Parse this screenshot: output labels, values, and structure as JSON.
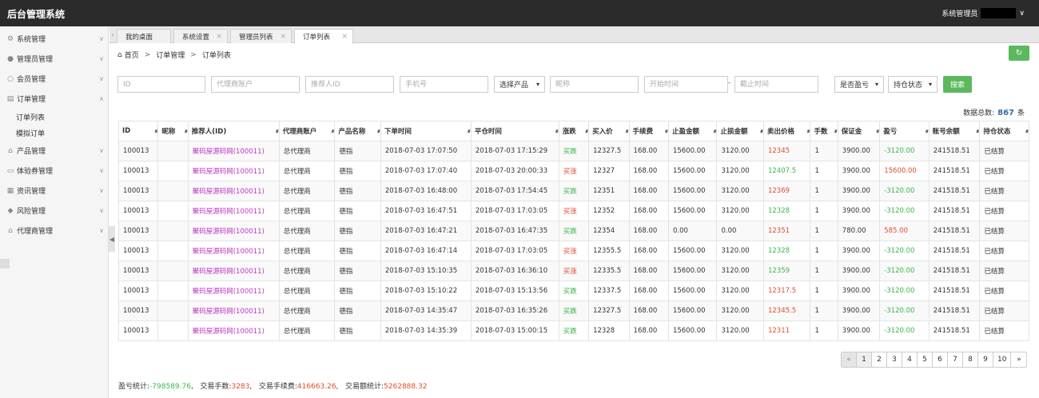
{
  "app": {
    "title": "后台管理系统",
    "user": "系统管理员"
  },
  "sidebar": {
    "items": [
      {
        "label": "系统管理",
        "icon": "gear-icon",
        "glyph": "⚙",
        "arrow": "∨"
      },
      {
        "label": "管理员管理",
        "icon": "user-icon",
        "glyph": "●",
        "arrow": "∨"
      },
      {
        "label": "会员管理",
        "icon": "member-icon",
        "glyph": "○",
        "arrow": "∨"
      },
      {
        "label": "订单管理",
        "icon": "order-icon",
        "glyph": "▤",
        "arrow": "∧"
      },
      {
        "label": "产品管理",
        "icon": "product-icon",
        "glyph": "⌂",
        "arrow": "∨"
      },
      {
        "label": "体验券管理",
        "icon": "coupon-icon",
        "glyph": "▭",
        "arrow": "∨"
      },
      {
        "label": "资讯管理",
        "icon": "news-icon",
        "glyph": "▦",
        "arrow": "∨"
      },
      {
        "label": "风险管理",
        "icon": "shield-icon",
        "glyph": "◆",
        "arrow": "∨"
      },
      {
        "label": "代理商管理",
        "icon": "agent-icon",
        "glyph": "⌂",
        "arrow": "∨"
      }
    ],
    "sub_items": [
      "订单列表",
      "模拟订单"
    ]
  },
  "tabs": [
    {
      "label": "我的桌面",
      "closable": false
    },
    {
      "label": "系统设置",
      "closable": true
    },
    {
      "label": "管理员列表",
      "closable": true
    },
    {
      "label": "订单列表",
      "closable": true,
      "active": true
    }
  ],
  "breadcrumb": [
    "首页",
    "订单管理",
    "订单列表"
  ],
  "filters": {
    "id": "ID",
    "agent_account": "代理商账户",
    "referrer_id": "推荐人ID",
    "phone": "手机号",
    "product_select": "选择产品",
    "nickname": "昵称",
    "start_time": "开始时间",
    "end_time": "截止时间",
    "profit_select": "是否盈亏",
    "position_select": "持仓状态",
    "search_label": "搜索"
  },
  "total": {
    "label": "数据总数:",
    "count": "867",
    "unit": "条"
  },
  "table": {
    "headers": [
      "ID",
      "昵称",
      "推荐人(ID)",
      "代理商账户",
      "产品名称",
      "下单时间",
      "平仓时间",
      "涨跌",
      "买入价",
      "手续费",
      "止盈金额",
      "止损金额",
      "卖出价格",
      "手数",
      "保证金",
      "盈亏",
      "账号余额",
      "持仓状态"
    ],
    "rows": [
      [
        "100013",
        "",
        "聚码屋源码网(100011)",
        "总代理商",
        "德指",
        "2018-07-03 17:07:50",
        "2018-07-03 17:15:29",
        "买跌",
        "12327.5",
        "168.00",
        "15600.00",
        "3120.00",
        "12345",
        "1",
        "3900.00",
        "-3120.00",
        "241518.51",
        "已结算"
      ],
      [
        "100013",
        "",
        "聚码屋源码网(100011)",
        "总代理商",
        "德指",
        "2018-07-03 17:07:40",
        "2018-07-03 20:00:33",
        "买涨",
        "12327",
        "168.00",
        "15600.00",
        "3120.00",
        "12407.5",
        "1",
        "3900.00",
        "15600.00",
        "241518.51",
        "已结算"
      ],
      [
        "100013",
        "",
        "聚码屋源码网(100011)",
        "总代理商",
        "德指",
        "2018-07-03 16:48:00",
        "2018-07-03 17:54:45",
        "买跌",
        "12351",
        "168.00",
        "15600.00",
        "3120.00",
        "12369",
        "1",
        "3900.00",
        "-3120.00",
        "241518.51",
        "已结算"
      ],
      [
        "100013",
        "",
        "聚码屋源码网(100011)",
        "总代理商",
        "德指",
        "2018-07-03 16:47:51",
        "2018-07-03 17:03:05",
        "买涨",
        "12352",
        "168.00",
        "15600.00",
        "3120.00",
        "12328",
        "1",
        "3900.00",
        "-3120.00",
        "241518.51",
        "已结算"
      ],
      [
        "100013",
        "",
        "聚码屋源码网(100011)",
        "总代理商",
        "德指",
        "2018-07-03 16:47:21",
        "2018-07-03 16:47:35",
        "买跌",
        "12354",
        "168.00",
        "0.00",
        "0.00",
        "12351",
        "1",
        "780.00",
        "585.00",
        "241518.51",
        "已结算"
      ],
      [
        "100013",
        "",
        "聚码屋源码网(100011)",
        "总代理商",
        "德指",
        "2018-07-03 16:47:14",
        "2018-07-03 17:03:05",
        "买涨",
        "12355.5",
        "168.00",
        "15600.00",
        "3120.00",
        "12328",
        "1",
        "3900.00",
        "-3120.00",
        "241518.51",
        "已结算"
      ],
      [
        "100013",
        "",
        "聚码屋源码网(100011)",
        "总代理商",
        "德指",
        "2018-07-03 15:10:35",
        "2018-07-03 16:36:10",
        "买涨",
        "12335.5",
        "168.00",
        "15600.00",
        "3120.00",
        "12359",
        "1",
        "3900.00",
        "-3120.00",
        "241518.51",
        "已结算"
      ],
      [
        "100013",
        "",
        "聚码屋源码网(100011)",
        "总代理商",
        "德指",
        "2018-07-03 15:10:22",
        "2018-07-03 15:13:56",
        "买跌",
        "12337.5",
        "168.00",
        "15600.00",
        "3120.00",
        "12317.5",
        "1",
        "3900.00",
        "-3120.00",
        "241518.51",
        "已结算"
      ],
      [
        "100013",
        "",
        "聚码屋源码网(100011)",
        "总代理商",
        "德指",
        "2018-07-03 14:35:47",
        "2018-07-03 16:35:26",
        "买跌",
        "12327.5",
        "168.00",
        "15600.00",
        "3120.00",
        "12345.5",
        "1",
        "3900.00",
        "-3120.00",
        "241518.51",
        "已结算"
      ],
      [
        "100013",
        "",
        "聚码屋源码网(100011)",
        "总代理商",
        "德指",
        "2018-07-03 14:35:39",
        "2018-07-03 15:00:15",
        "买跌",
        "12328",
        "168.00",
        "15600.00",
        "3120.00",
        "12311",
        "1",
        "3900.00",
        "-3120.00",
        "241518.51",
        "已结算"
      ]
    ]
  },
  "pagination": [
    "«",
    "1",
    "2",
    "3",
    "4",
    "5",
    "6",
    "7",
    "8",
    "9",
    "10",
    "»"
  ],
  "stats": {
    "profit_label": "盈亏统计:",
    "profit_value": "-798589.76",
    "lots_label": "交易手数:",
    "lots_value": "3283",
    "fee_label": "交易手续费:",
    "fee_value": "416663.26",
    "volume_label": "交易额统计:",
    "volume_value": "5262888.32"
  },
  "colors": {
    "accent_green": "#5cb85c",
    "rise": "#e04c2e",
    "fall": "#3cb54a",
    "referrer": "#c039c4",
    "total_count": "#2e6da4"
  }
}
